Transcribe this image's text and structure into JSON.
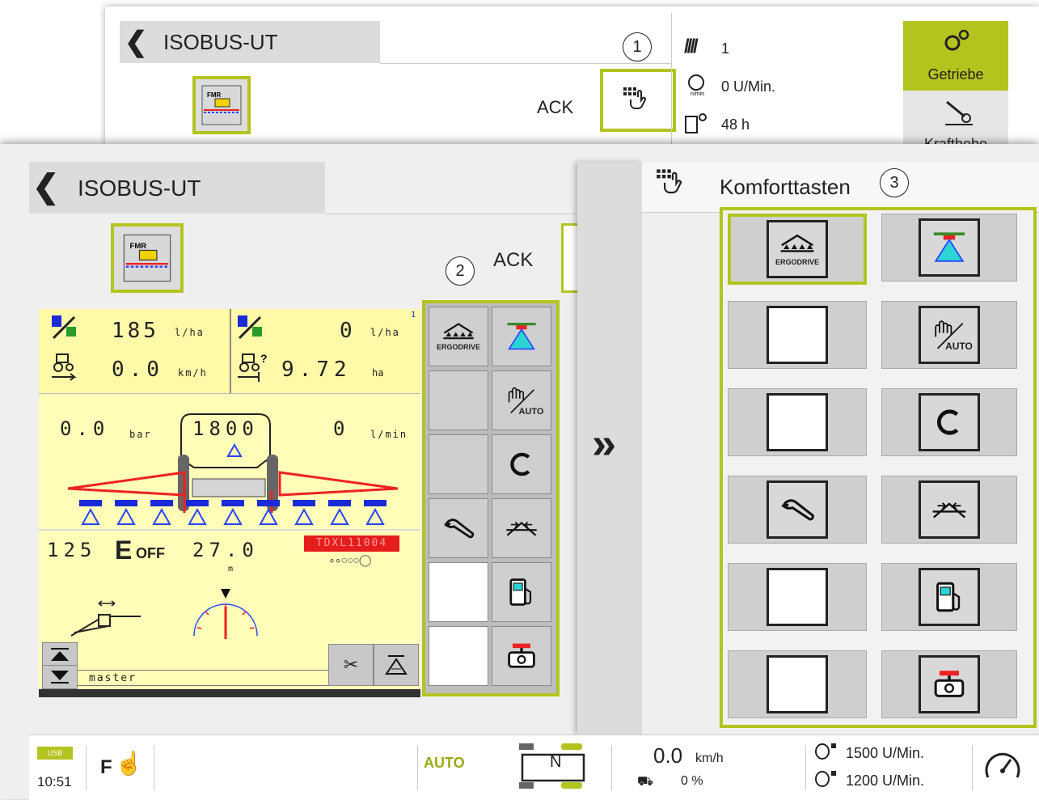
{
  "back_screen": {
    "title": "ISOBUS-UT",
    "implement_label": "ACK",
    "callout": "1",
    "info": {
      "gear": "1",
      "rpm": "0 U/Min.",
      "rpm_unit": "n/min",
      "hours": "48 h"
    },
    "side_buttons": [
      {
        "label": "Getriebe",
        "icon": "gears-icon"
      },
      {
        "label": "Krafthebe",
        "icon": "hitch-icon"
      }
    ],
    "accent": "#b3c41f"
  },
  "front_screen": {
    "title": "ISOBUS-UT",
    "implement_label": "ACK",
    "callout_2": "2",
    "sprayer": {
      "rate_set": "185",
      "rate_set_unit": "l/ha",
      "rate_actual": "0",
      "rate_actual_unit": "l/ha",
      "page_index": "1",
      "speed": "0.0",
      "speed_unit": "km/h",
      "area": "9.72",
      "area_unit": "ha",
      "pressure": "0.0",
      "pressure_unit": "bar",
      "tank": "1800",
      "flow": "0",
      "flow_unit": "l/min",
      "section_value": "125",
      "e_label": "E",
      "off_label": "OFF",
      "width": "27.0",
      "width_unit": "m",
      "nozzle": "TDXL11004",
      "footer_label": "master"
    },
    "ut_buttons": [
      {
        "name": "ergodrive",
        "icon": "ergodrive-icon"
      },
      {
        "name": "spray",
        "icon": "spray-nozzle-icon"
      },
      {
        "name": "empty1",
        "icon": ""
      },
      {
        "name": "manual-auto",
        "icon": "manual-auto-icon"
      },
      {
        "name": "empty2",
        "icon": ""
      },
      {
        "name": "c",
        "icon": "c-icon"
      },
      {
        "name": "wrench",
        "icon": "wrench-icon"
      },
      {
        "name": "boom-fold",
        "icon": "boom-fold-icon"
      },
      {
        "name": "white1",
        "icon": ""
      },
      {
        "name": "fuel",
        "icon": "fuel-icon"
      },
      {
        "name": "white2",
        "icon": ""
      },
      {
        "name": "valve",
        "icon": "valve-icon"
      }
    ],
    "ergodrive_text": "ERGODRIVE",
    "auto_text": "AUTO",
    "c_text": "C"
  },
  "comfort_panel": {
    "title": "Komforttasten",
    "callout": "3",
    "expand_glyph": "»"
  },
  "status_bar": {
    "usb": "USB",
    "time": "10:51",
    "f_label": "F",
    "auto": "AUTO",
    "gear_n": "N",
    "speed": "0.0",
    "speed_unit": "km/h",
    "slip": "0 %",
    "rpm1": "1500 U/Min.",
    "rpm2": "1200 U/Min."
  }
}
